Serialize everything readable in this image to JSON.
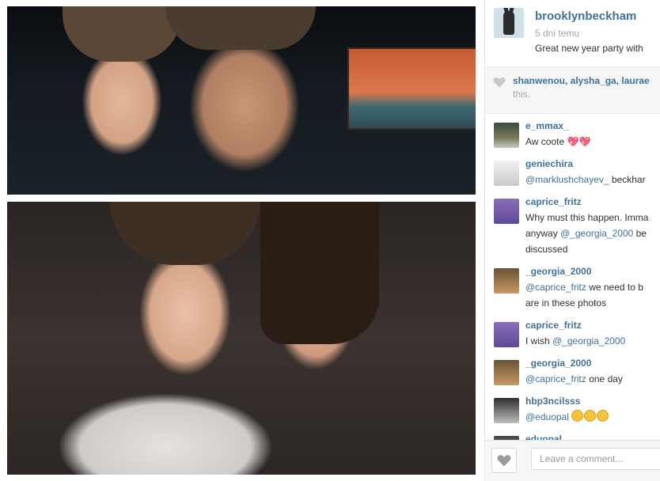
{
  "post": {
    "username": "brooklynbeckham",
    "time_ago": "5 dni temu",
    "caption": "Great new year party with"
  },
  "likes": {
    "names": "shanwenou, alysha_ga, laurae",
    "tail": "this."
  },
  "comments": [
    {
      "user": "e_mmax_",
      "text": "Aw coote"
    },
    {
      "user": "geniechira",
      "mention": "@marklushchayev_",
      "text": " beckhar"
    },
    {
      "user": "caprice_fritz",
      "line1": "Why must this happen. Imma",
      "line2_pre": "anyway ",
      "mention": "@_georgia_2000",
      "line2_post": " be",
      "line3": "discussed"
    },
    {
      "user": "_georgia_2000",
      "mention": "@caprice_fritz",
      "line1_post": " we need to b",
      "line2": "are in these photos"
    },
    {
      "user": "caprice_fritz",
      "pre": "I wish ",
      "mention": "@_georgia_2000"
    },
    {
      "user": "_georgia_2000",
      "mention": "@caprice_fritz",
      "text": " one day"
    },
    {
      "user": "hbp3ncilsss",
      "mention": "@eduopal"
    },
    {
      "user": "eduopal"
    }
  ],
  "footer": {
    "placeholder": "Leave a comment..."
  },
  "icons": {
    "like": "heart-icon",
    "footer_like": "heart-icon"
  }
}
